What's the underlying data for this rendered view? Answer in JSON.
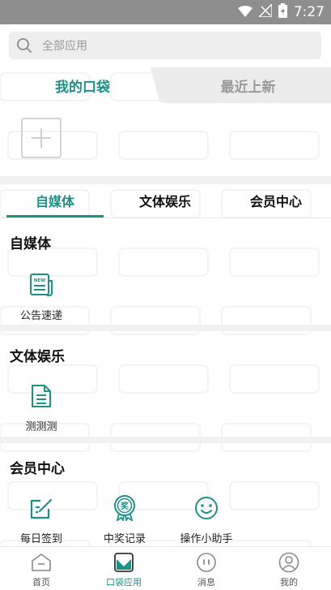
{
  "status_bar": {
    "time": "7:27"
  },
  "search": {
    "placeholder": "全部应用"
  },
  "pocket_tabs": {
    "mine": "我的口袋",
    "recent": "最近上新"
  },
  "category_tabs": [
    "自媒体",
    "文体娱乐",
    "会员中心"
  ],
  "sections": [
    {
      "title": "自媒体",
      "apps": [
        {
          "label": "公告速递",
          "icon": "news-icon",
          "badge": "NEW"
        }
      ]
    },
    {
      "title": "文体娱乐",
      "apps": [
        {
          "label": "测测测",
          "icon": "document-icon"
        }
      ]
    },
    {
      "title": "会员中心",
      "apps": [
        {
          "label": "每日签到",
          "icon": "edit-icon"
        },
        {
          "label": "中奖记录",
          "icon": "award-icon",
          "badge": "奖"
        },
        {
          "label": "操作小助手",
          "icon": "smile-icon"
        }
      ]
    }
  ],
  "bottom_nav": [
    {
      "label": "首页",
      "icon": "home-icon"
    },
    {
      "label": "口袋应用",
      "icon": "pocket-icon",
      "active": true
    },
    {
      "label": "消息",
      "icon": "message-icon"
    },
    {
      "label": "我的",
      "icon": "profile-icon"
    }
  ],
  "colors": {
    "accent": "#1e9087",
    "statusbar": "#8e8e8e",
    "separator": "#f1f1f1"
  }
}
